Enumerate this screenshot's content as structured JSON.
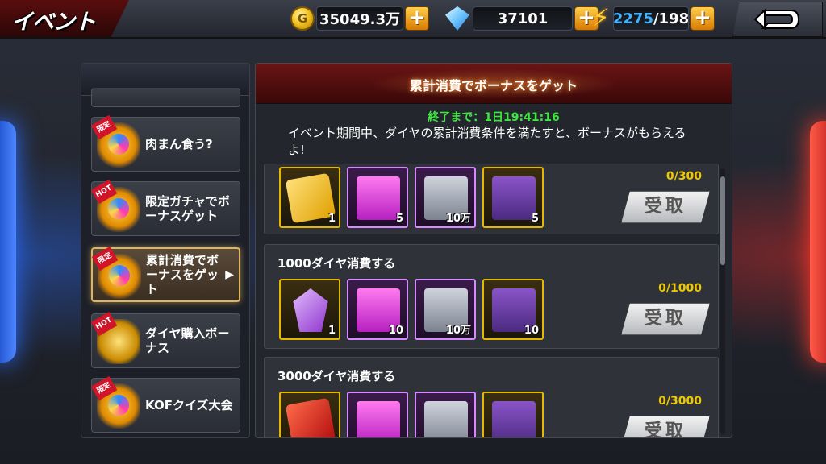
{
  "header": {
    "title": "イベント",
    "coins": "35049.3万",
    "gems": "37101",
    "stamina_current": "2275",
    "stamina_max": "/198"
  },
  "sidebar": {
    "items": [
      {
        "label": "肉まん食う?",
        "badge": "限定"
      },
      {
        "label": "限定ガチャでボーナスゲット",
        "badge": "HOT"
      },
      {
        "label": "累計消費でボーナスをゲット",
        "badge": "限定"
      },
      {
        "label": "ダイヤ購入ボーナス",
        "badge": "HOT"
      },
      {
        "label": "KOFクイズ大会",
        "badge": "限定"
      }
    ]
  },
  "main": {
    "banner_title": "累計消費でボーナスをゲット",
    "timer": "終了まで：1日19:41:16",
    "description": "イベント期間中、ダイヤの累計消費条件を満たすと、ボーナスがもらえるよ!",
    "rows": [
      {
        "title": "",
        "progress": "0/300",
        "claim_label": "受取",
        "items": [
          {
            "icon": "ur-ticket",
            "qty": "1"
          },
          {
            "icon": "gift-box",
            "qty": "5"
          },
          {
            "icon": "safe",
            "qty": "10万"
          },
          {
            "icon": "treasure-chest",
            "qty": "5"
          }
        ]
      },
      {
        "title": "1000ダイヤ消費する",
        "progress": "0/1000",
        "claim_label": "受取",
        "items": [
          {
            "icon": "crystal",
            "qty": "1"
          },
          {
            "icon": "gift-box",
            "qty": "10"
          },
          {
            "icon": "safe",
            "qty": "10万"
          },
          {
            "icon": "treasure-chest",
            "qty": "10"
          }
        ]
      },
      {
        "title": "3000ダイヤ消費する",
        "progress": "0/3000",
        "claim_label": "受取",
        "items": [
          {
            "icon": "lr-ticket",
            "qty": ""
          },
          {
            "icon": "gift-box",
            "qty": ""
          },
          {
            "icon": "safe",
            "qty": ""
          },
          {
            "icon": "treasure-chest",
            "qty": ""
          }
        ]
      }
    ]
  },
  "colors": {
    "accent_gold": "#f0c800",
    "timer_green": "#3ee83e",
    "banner_red": "#6a1414"
  }
}
